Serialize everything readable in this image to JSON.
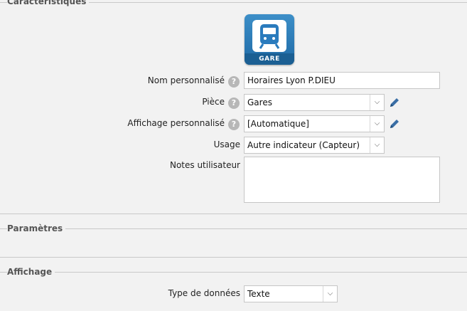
{
  "sections": {
    "caracteristiques": "Caractéristiques",
    "parametres": "Paramètres",
    "affichage": "Affichage"
  },
  "app_icon": {
    "label": "GARE",
    "icon": "train-icon",
    "color": "#2a7bbd"
  },
  "form": {
    "nom": {
      "label": "Nom personnalisé",
      "value": "Horaires Lyon P.DIEU"
    },
    "piece": {
      "label": "Pièce",
      "value": "Gares"
    },
    "affichage_perso": {
      "label": "Affichage personnalisé",
      "value": "[Automatique]"
    },
    "usage": {
      "label": "Usage",
      "value": "Autre indicateur (Capteur)"
    },
    "notes": {
      "label": "Notes utilisateur",
      "value": ""
    }
  },
  "affichage": {
    "type_donnees": {
      "label": "Type de données",
      "value": "Texte"
    }
  },
  "icons": {
    "help": "question-mark-icon",
    "edit": "pencil-icon",
    "dropdown": "chevron-down-icon"
  }
}
